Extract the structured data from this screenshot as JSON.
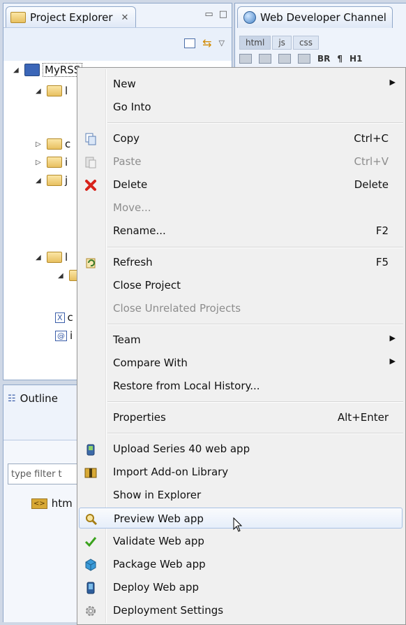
{
  "project_explorer": {
    "title": "Project Explorer",
    "close": "✕",
    "project_name": "MyRSS",
    "tree_rows": [
      {
        "label": "l"
      },
      {
        "label": "c"
      },
      {
        "label": "i"
      },
      {
        "label": "j"
      },
      {
        "label": "l"
      },
      {
        "label": "c"
      },
      {
        "label": "i"
      }
    ]
  },
  "outline": {
    "title": "Outline",
    "filter_placeholder": "type filter t",
    "node": "htm"
  },
  "web_developer": {
    "title": "Web Developer Channel",
    "tabs": [
      "html",
      "js",
      "css"
    ],
    "tools": [
      "BR",
      "¶",
      "H1"
    ]
  },
  "menu": {
    "items": [
      {
        "label": "New",
        "submenu": true
      },
      {
        "label": "Go Into"
      },
      {
        "label": "Copy",
        "shortcut": "Ctrl+C",
        "icon": "copy-icon"
      },
      {
        "label": "Paste",
        "shortcut": "Ctrl+V",
        "disabled": true,
        "icon": "paste-icon"
      },
      {
        "label": "Delete",
        "shortcut": "Delete",
        "icon": "delete-icon"
      },
      {
        "label": "Move...",
        "disabled": true
      },
      {
        "label": "Rename...",
        "shortcut": "F2"
      },
      {
        "label": "Refresh",
        "shortcut": "F5",
        "icon": "refresh-icon"
      },
      {
        "label": "Close Project"
      },
      {
        "label": "Close Unrelated Projects",
        "disabled": true
      },
      {
        "label": "Team",
        "submenu": true
      },
      {
        "label": "Compare With",
        "submenu": true
      },
      {
        "label": "Restore from Local History..."
      },
      {
        "label": "Properties",
        "shortcut": "Alt+Enter"
      },
      {
        "label": "Upload Series 40 web app",
        "icon": "upload-icon"
      },
      {
        "label": "Import Add-on Library",
        "icon": "library-icon"
      },
      {
        "label": "Show in Explorer"
      },
      {
        "label": "Preview Web app",
        "icon": "preview-icon",
        "highlighted": true
      },
      {
        "label": "Validate Web app",
        "icon": "checkmark-icon"
      },
      {
        "label": "Package Web app",
        "icon": "package-icon"
      },
      {
        "label": "Deploy Web app",
        "icon": "deploy-icon"
      },
      {
        "label": "Deployment Settings",
        "icon": "gear-icon"
      }
    ],
    "submenu_arrow": "▶"
  }
}
